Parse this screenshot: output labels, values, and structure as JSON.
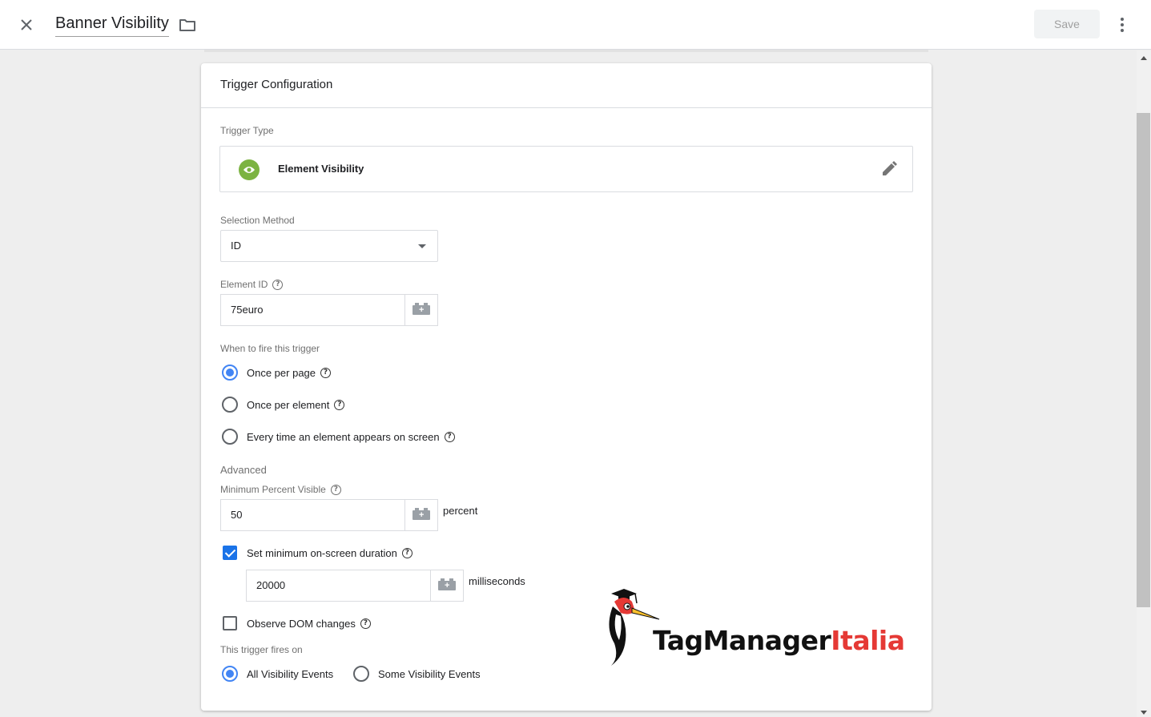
{
  "header": {
    "title": "Banner Visibility",
    "save_label": "Save",
    "icons": [
      "close-icon",
      "folder-icon",
      "more-vert-icon"
    ]
  },
  "card": {
    "title": "Trigger Configuration",
    "trigger_type_label": "Trigger Type",
    "trigger_type_name": "Element Visibility",
    "trigger_type_icon": "eye-icon",
    "trigger_type_color": "#7cb342",
    "selection_method_label": "Selection Method",
    "selection_method_value": "ID",
    "element_id_label": "Element ID",
    "element_id_value": "75euro",
    "fire_label": "When to fire this trigger",
    "fire_options": [
      "Once per page",
      "Once per element",
      "Every time an element appears on screen"
    ],
    "fire_selected": "Once per page",
    "advanced_label": "Advanced",
    "min_percent_label": "Minimum Percent Visible",
    "min_percent_value": "50",
    "percent_unit": "percent",
    "min_duration_label": "Set minimum on-screen duration",
    "min_duration_checked": true,
    "min_duration_value": "20000",
    "ms_unit": "milliseconds",
    "observe_dom_label": "Observe DOM changes",
    "observe_dom_checked": false,
    "fires_on_label": "This trigger fires on",
    "fires_on_options": [
      "All Visibility Events",
      "Some Visibility Events"
    ],
    "fires_on_selected": "All Visibility Events"
  },
  "watermark": {
    "part1": "TagManager",
    "part2": "Italia"
  },
  "colors": {
    "accent": "#4285f4",
    "checkbox": "#1a73e8",
    "brand_red": "#e53935"
  }
}
